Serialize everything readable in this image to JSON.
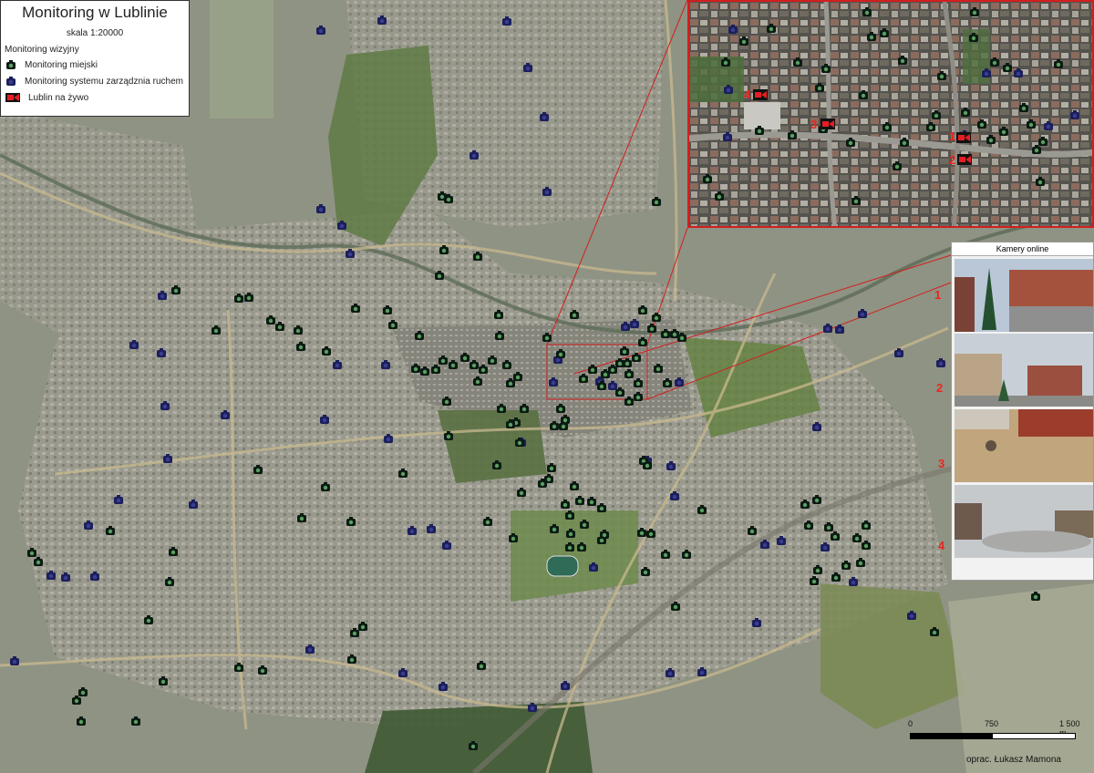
{
  "legend": {
    "title": "Monitoring w Lublinie",
    "scale": "skala 1:20000",
    "group": "Monitoring wizyjny",
    "items": [
      {
        "label": "Monitoring miejski",
        "icon": "city-camera-icon",
        "color": "#0b1a12",
        "lens": "#59a060"
      },
      {
        "label": "Monitoring systemu zarządznia ruchem",
        "icon": "traffic-camera-icon",
        "color": "#1c1f5c"
      },
      {
        "label": "Lublin na żywo",
        "icon": "live-camera-icon",
        "color": "#e31e24"
      }
    ]
  },
  "panel": {
    "title": "Kamery online",
    "cameras": [
      "1",
      "2",
      "3",
      "4"
    ]
  },
  "inset_labels": [
    "1",
    "2",
    "3",
    "4"
  ],
  "scalebar": {
    "labels": [
      "0",
      "750",
      "1 500 m"
    ]
  },
  "credit": "oprac. Łukasz Mamona",
  "colors": {
    "accent": "#d21f1f",
    "city": "#0b1a12",
    "traffic": "#1c1f5c"
  }
}
